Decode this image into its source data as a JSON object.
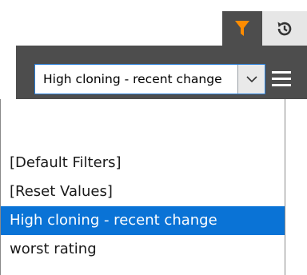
{
  "toolbar": {
    "filter_icon": "filter-funnel-icon",
    "history_icon": "history-icon",
    "accent_color": "#ff8c00"
  },
  "combo": {
    "value": "High cloning - recent change",
    "arrow_icon": "chevron-down-icon"
  },
  "menu": {
    "icon": "hamburger-menu-icon"
  },
  "dropdown": {
    "items": [
      {
        "label": "",
        "selected": false
      },
      {
        "label": "[Default Filters]",
        "selected": false
      },
      {
        "label": "[Reset Values]",
        "selected": false
      },
      {
        "label": "High cloning - recent change",
        "selected": true
      },
      {
        "label": "worst rating",
        "selected": false
      }
    ],
    "selected_color": "#0a73d6"
  }
}
